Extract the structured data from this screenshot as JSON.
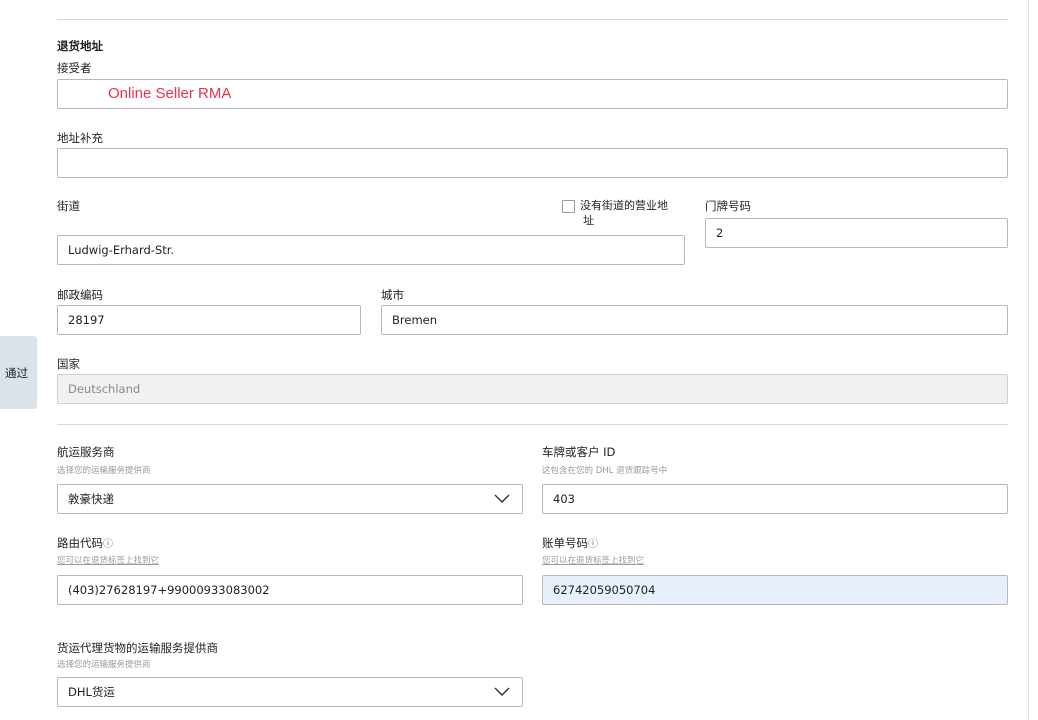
{
  "side_tab": {
    "label": "通过"
  },
  "return_address": {
    "section_title": "退货地址",
    "recipient_label": "接受者",
    "recipient_value": "Online Seller RMA",
    "address_supplement_label": "地址补充",
    "address_supplement_value": "",
    "street_label": "街道",
    "street_value": "Ludwig-Erhard-Str.",
    "no_street_checkbox_label_line1": "没有街道的营业地",
    "no_street_checkbox_label_line2": "址",
    "no_street_checked": false,
    "house_number_label": "门牌号码",
    "house_number_value": "2",
    "postal_code_label": "邮政编码",
    "postal_code_value": "28197",
    "city_label": "城市",
    "city_value": "Bremen",
    "country_label": "国家",
    "country_value": "Deutschland"
  },
  "shipping": {
    "carrier_label": "航运服务商",
    "carrier_hint": "选择您的运输服务提供商",
    "carrier_value": "敦豪快递",
    "customer_id_label": "车牌或客户 ID",
    "customer_id_hint": "这包含在您的 DHL 退货跟踪号中",
    "customer_id_value": "403",
    "routing_code_label": "路由代码",
    "routing_code_hint": "您可以在退货标签上找到它",
    "routing_code_value": "(403)27628197+99000933083002",
    "bill_number_label": "账单号码",
    "bill_number_hint": "您可以在退货标签上找到它",
    "bill_number_value": "62742059050704",
    "freight_carrier_label": "货运代理货物的运输服务提供商",
    "freight_carrier_hint": "选择您的运输服务提供商",
    "freight_carrier_value": "DHL货运"
  },
  "icons": {
    "info": "ⓘ",
    "dropdown": "chevron-down-icon"
  }
}
